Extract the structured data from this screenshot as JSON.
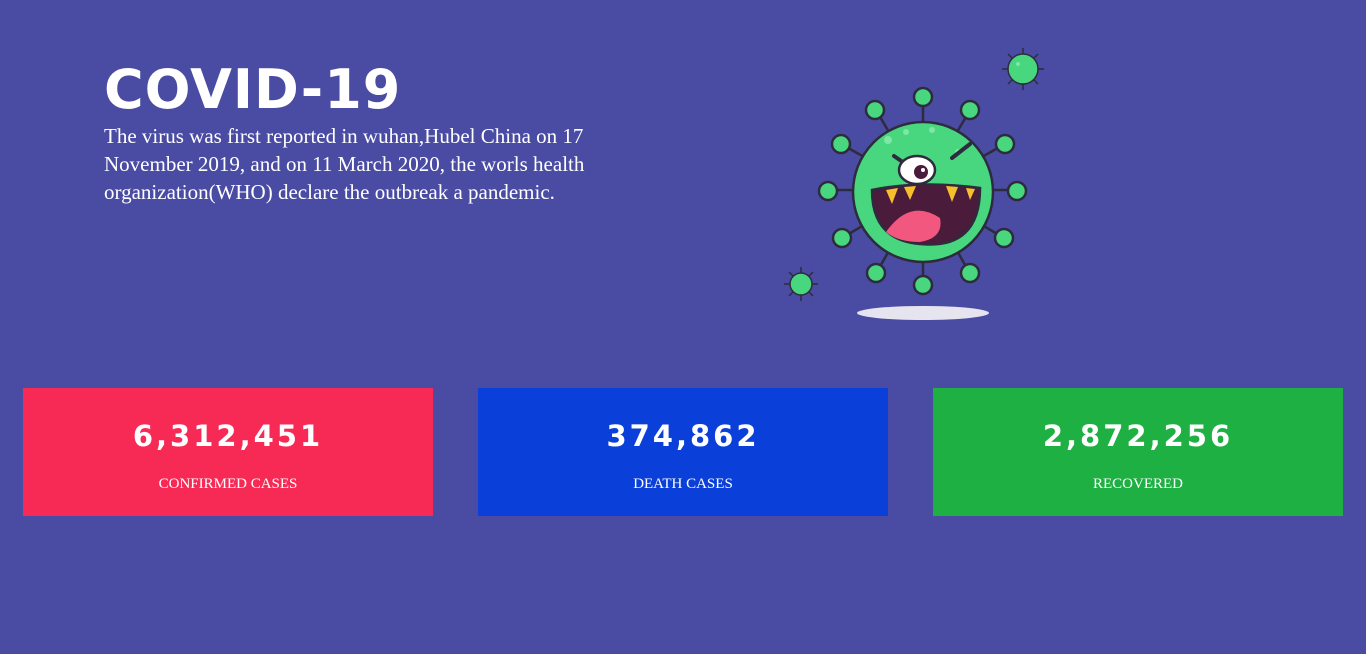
{
  "hero": {
    "title": "COVID-19",
    "description": "The virus was first reported in wuhan,Hubel China on 17 November 2019, and on 11 March 2020, the worls health organization(WHO) declare the outbreak a pandemic."
  },
  "illustration": {
    "icon": "virus-icon",
    "body_color": "#48d67e",
    "outline_color": "#2d2b3d",
    "mouth_color": "#4a1b3a",
    "tongue_color": "#f2577f",
    "tooth_color": "#f5c02a"
  },
  "stats": [
    {
      "value": "6,312,451",
      "label": "CONFIRMED CASES",
      "color": "#f72a55"
    },
    {
      "value": "374,862",
      "label": "DEATH CASES",
      "color": "#0a3fd9"
    },
    {
      "value": "2,872,256",
      "label": "RECOVERED",
      "color": "#1fb043"
    }
  ],
  "theme": {
    "background": "#4a4ca3"
  }
}
